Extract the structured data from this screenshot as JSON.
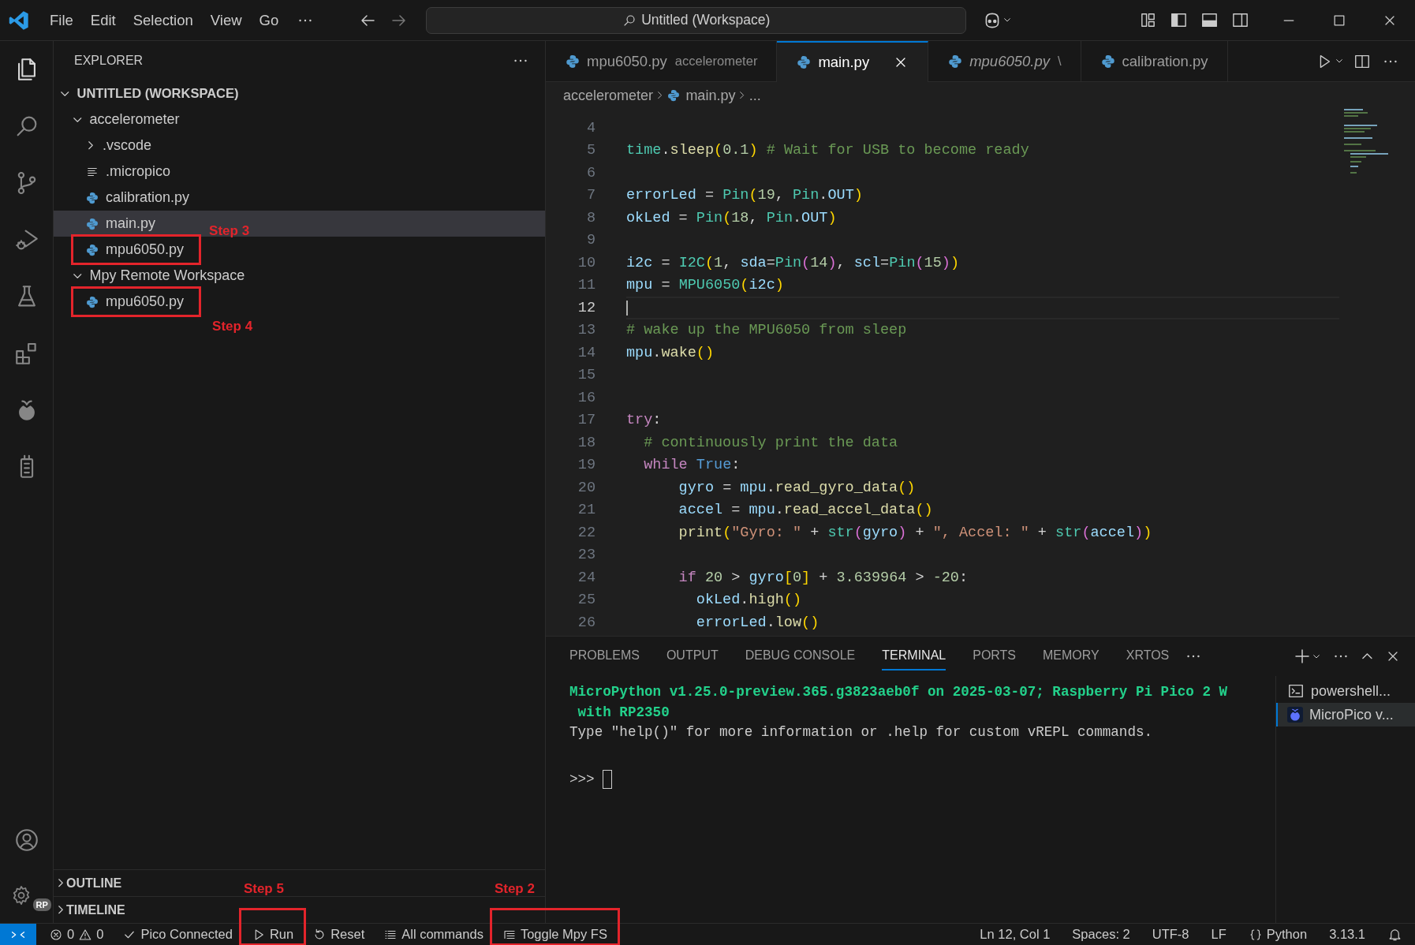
{
  "title_bar": {
    "menu": [
      "File",
      "Edit",
      "Selection",
      "View",
      "Go"
    ],
    "search": "Untitled (Workspace)"
  },
  "activity_bar": {
    "top": [
      {
        "kind": "explorer",
        "selected": true
      },
      {
        "kind": "search",
        "selected": false
      },
      {
        "kind": "source-control",
        "selected": false
      },
      {
        "kind": "run-debug",
        "selected": false
      },
      {
        "kind": "testing",
        "selected": false
      },
      {
        "kind": "extensions",
        "selected": false
      },
      {
        "kind": "micropico",
        "selected": false
      },
      {
        "kind": "device",
        "selected": false
      }
    ],
    "bottom": [
      {
        "kind": "account"
      },
      {
        "kind": "settings",
        "badge": "RP"
      }
    ]
  },
  "sidebar": {
    "title": "EXPLORER",
    "tree": [
      {
        "label": "UNTITLED (WORKSPACE)",
        "kind": "root",
        "expanded": true,
        "children": [
          {
            "label": "accelerometer",
            "kind": "folder",
            "expanded": true,
            "children": [
              {
                "label": ".vscode",
                "kind": "folder",
                "expanded": false
              },
              {
                "label": ".micropico",
                "kind": "text-file",
                "selected": false
              },
              {
                "label": "calibration.py",
                "kind": "python-file",
                "selected": false
              },
              {
                "label": "main.py",
                "kind": "python-file",
                "selected": true
              },
              {
                "label": "mpu6050.py",
                "kind": "python-file",
                "selected": false,
                "callout": "Step 3"
              }
            ]
          },
          {
            "label": "Mpy Remote Workspace",
            "kind": "folder",
            "expanded": true,
            "children": [
              {
                "label": "mpu6050.py",
                "kind": "python-file",
                "selected": false,
                "callout": "Step 4"
              }
            ]
          }
        ]
      }
    ],
    "sections": [
      {
        "label": "OUTLINE",
        "expanded": false
      },
      {
        "label": "TIMELINE",
        "expanded": false
      }
    ]
  },
  "editor": {
    "tabs": [
      {
        "label": "mpu6050.py",
        "description": "accelerometer",
        "selected": false,
        "preview": false
      },
      {
        "label": "main.py",
        "selected": true,
        "preview": false
      },
      {
        "label": "mpu6050.py",
        "description": "\\",
        "selected": false,
        "preview": true
      },
      {
        "label": "calibration.py",
        "selected": false,
        "preview": false
      }
    ],
    "breadcrumbs": [
      {
        "label": "accelerometer",
        "kind": "folder"
      },
      {
        "label": "main.py",
        "kind": "python-file"
      },
      {
        "label": "...",
        "kind": "more"
      }
    ],
    "lines": [
      {
        "number": "4"
      },
      {
        "number": "5",
        "tokens": [
          {
            "text": "time",
            "kind": "cls"
          },
          {
            "text": ".",
            "kind": "op"
          },
          {
            "text": "sleep",
            "kind": "fn"
          },
          {
            "text": "(",
            "kind": "br1"
          },
          {
            "text": "0.1",
            "kind": "num"
          },
          {
            "text": ")",
            "kind": "br1"
          },
          {
            "text": " # Wait for USB to become ready",
            "kind": "cmt"
          }
        ]
      },
      {
        "number": "6"
      },
      {
        "number": "7",
        "tokens": [
          {
            "text": "errorLed",
            "kind": "var"
          },
          {
            "text": " = ",
            "kind": "op"
          },
          {
            "text": "Pin",
            "kind": "cls"
          },
          {
            "text": "(",
            "kind": "br1"
          },
          {
            "text": "19",
            "kind": "num"
          },
          {
            "text": ", ",
            "kind": "op"
          },
          {
            "text": "Pin",
            "kind": "cls"
          },
          {
            "text": ".",
            "kind": "op"
          },
          {
            "text": "OUT",
            "kind": "var"
          },
          {
            "text": ")",
            "kind": "br1"
          }
        ]
      },
      {
        "number": "8",
        "tokens": [
          {
            "text": "okLed",
            "kind": "var"
          },
          {
            "text": " = ",
            "kind": "op"
          },
          {
            "text": "Pin",
            "kind": "cls"
          },
          {
            "text": "(",
            "kind": "br1"
          },
          {
            "text": "18",
            "kind": "num"
          },
          {
            "text": ", ",
            "kind": "op"
          },
          {
            "text": "Pin",
            "kind": "cls"
          },
          {
            "text": ".",
            "kind": "op"
          },
          {
            "text": "OUT",
            "kind": "var"
          },
          {
            "text": ")",
            "kind": "br1"
          }
        ]
      },
      {
        "number": "9"
      },
      {
        "number": "10",
        "tokens": [
          {
            "text": "i2c",
            "kind": "var"
          },
          {
            "text": " = ",
            "kind": "op"
          },
          {
            "text": "I2C",
            "kind": "cls"
          },
          {
            "text": "(",
            "kind": "br1"
          },
          {
            "text": "1",
            "kind": "num"
          },
          {
            "text": ", ",
            "kind": "op"
          },
          {
            "text": "sda",
            "kind": "var"
          },
          {
            "text": "=",
            "kind": "op"
          },
          {
            "text": "Pin",
            "kind": "cls"
          },
          {
            "text": "(",
            "kind": "br2"
          },
          {
            "text": "14",
            "kind": "num"
          },
          {
            "text": ")",
            "kind": "br2"
          },
          {
            "text": ", ",
            "kind": "op"
          },
          {
            "text": "scl",
            "kind": "var"
          },
          {
            "text": "=",
            "kind": "op"
          },
          {
            "text": "Pin",
            "kind": "cls"
          },
          {
            "text": "(",
            "kind": "br2"
          },
          {
            "text": "15",
            "kind": "num"
          },
          {
            "text": ")",
            "kind": "br2"
          },
          {
            "text": ")",
            "kind": "br1"
          }
        ]
      },
      {
        "number": "11",
        "tokens": [
          {
            "text": "mpu",
            "kind": "var"
          },
          {
            "text": " = ",
            "kind": "op"
          },
          {
            "text": "MPU6050",
            "kind": "cls"
          },
          {
            "text": "(",
            "kind": "br1"
          },
          {
            "text": "i2c",
            "kind": "var"
          },
          {
            "text": ")",
            "kind": "br1"
          }
        ]
      },
      {
        "number": "12",
        "current": true
      },
      {
        "number": "13",
        "tokens": [
          {
            "text": "# wake up the MPU6050 from sleep",
            "kind": "cmt"
          }
        ]
      },
      {
        "number": "14",
        "tokens": [
          {
            "text": "mpu",
            "kind": "var"
          },
          {
            "text": ".",
            "kind": "op"
          },
          {
            "text": "wake",
            "kind": "fn"
          },
          {
            "text": "()",
            "kind": "br1"
          }
        ]
      },
      {
        "number": "15"
      },
      {
        "number": "16"
      },
      {
        "number": "17",
        "tokens": [
          {
            "text": "try",
            "kind": "kw"
          },
          {
            "text": ":",
            "kind": "op"
          }
        ]
      },
      {
        "number": "18",
        "tokens": [
          {
            "text": "  # continuously print the data",
            "kind": "cmt"
          }
        ]
      },
      {
        "number": "19",
        "tokens": [
          {
            "text": "  while",
            "kind": "kw"
          },
          {
            "text": " True",
            "kind": "const"
          },
          {
            "text": ":",
            "kind": "op"
          }
        ]
      },
      {
        "number": "20",
        "tokens": [
          {
            "text": "      gyro",
            "kind": "var"
          },
          {
            "text": " = ",
            "kind": "op"
          },
          {
            "text": "mpu",
            "kind": "var"
          },
          {
            "text": ".",
            "kind": "op"
          },
          {
            "text": "read_gyro_data",
            "kind": "fn"
          },
          {
            "text": "()",
            "kind": "br1"
          }
        ]
      },
      {
        "number": "21",
        "tokens": [
          {
            "text": "      accel",
            "kind": "var"
          },
          {
            "text": " = ",
            "kind": "op"
          },
          {
            "text": "mpu",
            "kind": "var"
          },
          {
            "text": ".",
            "kind": "op"
          },
          {
            "text": "read_accel_data",
            "kind": "fn"
          },
          {
            "text": "()",
            "kind": "br1"
          }
        ]
      },
      {
        "number": "22",
        "tokens": [
          {
            "text": "      print",
            "kind": "fn"
          },
          {
            "text": "(",
            "kind": "br1"
          },
          {
            "text": "\"Gyro: \"",
            "kind": "str"
          },
          {
            "text": " + ",
            "kind": "op"
          },
          {
            "text": "str",
            "kind": "cls"
          },
          {
            "text": "(",
            "kind": "br2"
          },
          {
            "text": "gyro",
            "kind": "var"
          },
          {
            "text": ")",
            "kind": "br2"
          },
          {
            "text": " + ",
            "kind": "op"
          },
          {
            "text": "\", Accel: \"",
            "kind": "str"
          },
          {
            "text": " + ",
            "kind": "op"
          },
          {
            "text": "str",
            "kind": "cls"
          },
          {
            "text": "(",
            "kind": "br2"
          },
          {
            "text": "accel",
            "kind": "var"
          },
          {
            "text": ")",
            "kind": "br2"
          },
          {
            "text": ")",
            "kind": "br1"
          }
        ]
      },
      {
        "number": "23"
      },
      {
        "number": "24",
        "tokens": [
          {
            "text": "      if",
            "kind": "kw"
          },
          {
            "text": " 20",
            "kind": "num"
          },
          {
            "text": " > ",
            "kind": "op"
          },
          {
            "text": "gyro",
            "kind": "var"
          },
          {
            "text": "[",
            "kind": "br1"
          },
          {
            "text": "0",
            "kind": "num"
          },
          {
            "text": "]",
            "kind": "br1"
          },
          {
            "text": " + ",
            "kind": "op"
          },
          {
            "text": "3.639964",
            "kind": "num"
          },
          {
            "text": " > ",
            "kind": "op"
          },
          {
            "text": "-20",
            "kind": "num"
          },
          {
            "text": ":",
            "kind": "op"
          }
        ]
      },
      {
        "number": "25",
        "tokens": [
          {
            "text": "        okLed",
            "kind": "var"
          },
          {
            "text": ".",
            "kind": "op"
          },
          {
            "text": "high",
            "kind": "fn"
          },
          {
            "text": "()",
            "kind": "br1"
          }
        ]
      },
      {
        "number": "26",
        "tokens": [
          {
            "text": "        errorLed",
            "kind": "var"
          },
          {
            "text": ".",
            "kind": "op"
          },
          {
            "text": "low",
            "kind": "fn"
          },
          {
            "text": "()",
            "kind": "br1"
          }
        ]
      }
    ]
  },
  "panel": {
    "tabs": [
      {
        "label": "PROBLEMS",
        "selected": false
      },
      {
        "label": "OUTPUT",
        "selected": false
      },
      {
        "label": "DEBUG CONSOLE",
        "selected": false
      },
      {
        "label": "TERMINAL",
        "selected": true
      },
      {
        "label": "PORTS",
        "selected": false
      },
      {
        "label": "MEMORY",
        "selected": false
      },
      {
        "label": "XRTOS",
        "selected": false
      }
    ],
    "terminal": [
      {
        "kind": "banner",
        "text": "MicroPython v1.25.0-preview.365.g3823aeb0f on 2025-03-07; Raspberry Pi Pico 2 W"
      },
      {
        "kind": "banner",
        "text": " with RP2350"
      },
      {
        "kind": "plain",
        "text": "Type \"help()\" for more information or .help for custom vREPL commands."
      },
      {
        "kind": "blank"
      },
      {
        "kind": "prompt",
        "text": ">>>"
      }
    ],
    "sessions": [
      {
        "label": "powershell...",
        "kind": "shell",
        "selected": false
      },
      {
        "label": "MicroPico v...",
        "kind": "micropico",
        "selected": true
      }
    ]
  },
  "status_bar": {
    "left": [
      {
        "kind": "remote"
      },
      {
        "kind": "problems",
        "errors": "0",
        "warnings": "0"
      },
      {
        "kind": "check",
        "text": "Pico Connected"
      },
      {
        "kind": "play",
        "text": "Run",
        "callout": "Step 5"
      },
      {
        "kind": "reset",
        "text": "Reset"
      },
      {
        "kind": "list",
        "text": "All commands"
      },
      {
        "kind": "tree",
        "text": "Toggle Mpy FS",
        "callout": "Step 2"
      }
    ],
    "right": [
      {
        "kind": "text",
        "text": "Ln 12, Col 1"
      },
      {
        "kind": "text",
        "text": "Spaces: 2"
      },
      {
        "kind": "text",
        "text": "UTF-8"
      },
      {
        "kind": "text",
        "text": "LF"
      },
      {
        "kind": "braces",
        "text": "Python"
      },
      {
        "kind": "text",
        "text": "3.13.1"
      },
      {
        "kind": "bell"
      }
    ]
  }
}
